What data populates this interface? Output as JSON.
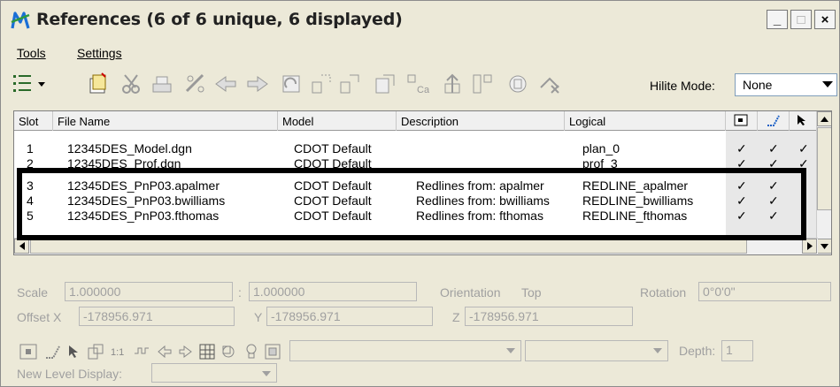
{
  "window": {
    "title": "References (6 of 6 unique, 6 displayed)",
    "minimize": "_",
    "maximize": "□",
    "close": "×"
  },
  "menu": {
    "tools": "Tools",
    "settings": "Settings"
  },
  "toolbar": {
    "hilite_label": "Hilite Mode:",
    "hilite_value": "None",
    "icons": [
      "list-display-icon",
      "attach-icon",
      "detach-icon",
      "reload-icon",
      "move-icon",
      "copy-icon",
      "rotate-icon",
      "mirror-horizontal-icon",
      "mirror-vertical-icon",
      "clip-boundary-icon",
      "clip-mask-icon",
      "delete-clip-icon",
      "clip-front-icon",
      "clip-back-icon",
      "exchange-icon",
      "make-direct-icon"
    ]
  },
  "table": {
    "columns": [
      "Slot",
      "File Name",
      "Model",
      "Description",
      "Logical"
    ],
    "rows": [
      {
        "slot": "1",
        "file": "12345DES_Model.dgn",
        "model": "CDOT Default",
        "description": "",
        "logical": "plan_0",
        "display": "✓",
        "snap": "✓",
        "locate": "✓"
      },
      {
        "slot": "2",
        "file": "12345DES_Prof.dgn",
        "model": "CDOT Default",
        "description": "",
        "logical": "prof_3",
        "display": "✓",
        "snap": "✓",
        "locate": "✓"
      },
      {
        "slot": "3",
        "file": "12345DES_PnP03.apalmer",
        "model": "CDOT Default",
        "description": "Redlines from: apalmer",
        "logical": "REDLINE_apalmer",
        "display": "✓",
        "snap": "✓",
        "locate": ""
      },
      {
        "slot": "4",
        "file": "12345DES_PnP03.bwilliams",
        "model": "CDOT Default",
        "description": "Redlines from: bwilliams",
        "logical": "REDLINE_bwilliams",
        "display": "✓",
        "snap": "✓",
        "locate": ""
      },
      {
        "slot": "5",
        "file": "12345DES_PnP03.fthomas",
        "model": "CDOT Default",
        "description": "Redlines from: fthomas",
        "logical": "REDLINE_fthomas",
        "display": "✓",
        "snap": "✓",
        "locate": ""
      }
    ]
  },
  "properties": {
    "scale_label": "Scale",
    "scale_master": "1.000000",
    "scale_sep": ":",
    "scale_ref": "1.000000",
    "orientation_label": "Orientation",
    "orientation_value": "Top",
    "rotation_label": "Rotation",
    "rotation_value": "0°0'0\"",
    "offset_x_label": "Offset X",
    "offset_x": "-178956.971",
    "offset_y_label": "Y",
    "offset_y": "-178956.971",
    "offset_z_label": "Z",
    "offset_z": "-178956.971",
    "depth_label": "Depth:",
    "depth_value": "1",
    "new_level_label": "New Level Display:"
  }
}
